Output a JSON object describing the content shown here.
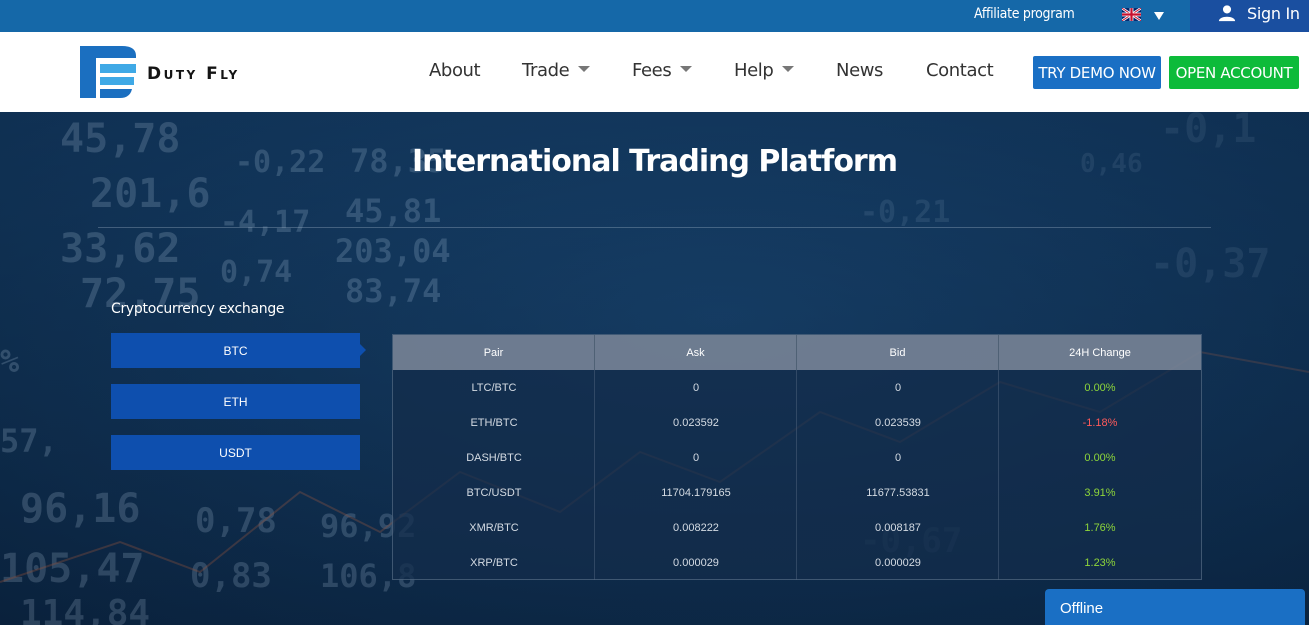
{
  "topbar": {
    "affiliate_label": "Affiliate program",
    "signin_label": "Sign In",
    "language": "English (UK)"
  },
  "logo": {
    "text": "Duty Fly"
  },
  "nav": {
    "about": "About",
    "trade": "Trade",
    "fees": "Fees",
    "help": "Help",
    "news": "News",
    "contact": "Contact"
  },
  "buttons": {
    "demo": "TRY DEMO NOW",
    "open": "OPEN ACCOUNT"
  },
  "hero": {
    "title": "International Trading Platform",
    "exchange_label": "Cryptocurrency exchange"
  },
  "tabs": [
    "BTC",
    "ETH",
    "USDT"
  ],
  "table": {
    "headers": [
      "Pair",
      "Ask",
      "Bid",
      "24H Change"
    ],
    "rows": [
      {
        "pair": "LTC/BTC",
        "ask": "0",
        "bid": "0",
        "change": "0.00%",
        "trend": "up"
      },
      {
        "pair": "ETH/BTC",
        "ask": "0.023592",
        "bid": "0.023539",
        "change": "-1.18%",
        "trend": "down"
      },
      {
        "pair": "DASH/BTC",
        "ask": "0",
        "bid": "0",
        "change": "0.00%",
        "trend": "up"
      },
      {
        "pair": "BTC/USDT",
        "ask": "11704.179165",
        "bid": "11677.53831",
        "change": "3.91%",
        "trend": "up"
      },
      {
        "pair": "XMR/BTC",
        "ask": "0.008222",
        "bid": "0.008187",
        "change": "1.76%",
        "trend": "up"
      },
      {
        "pair": "XRP/BTC",
        "ask": "0.000029",
        "bid": "0.000029",
        "change": "1.23%",
        "trend": "up"
      }
    ]
  },
  "chat": {
    "status": "Offline"
  },
  "colors": {
    "topbar": "#1568a8",
    "signin_bg": "#1a4fa0",
    "demo_button": "#1a6fc4",
    "open_button": "#0dbb3a",
    "tab": "#0e4fae",
    "positive": "#8ed63a",
    "negative": "#ff5a5a"
  }
}
